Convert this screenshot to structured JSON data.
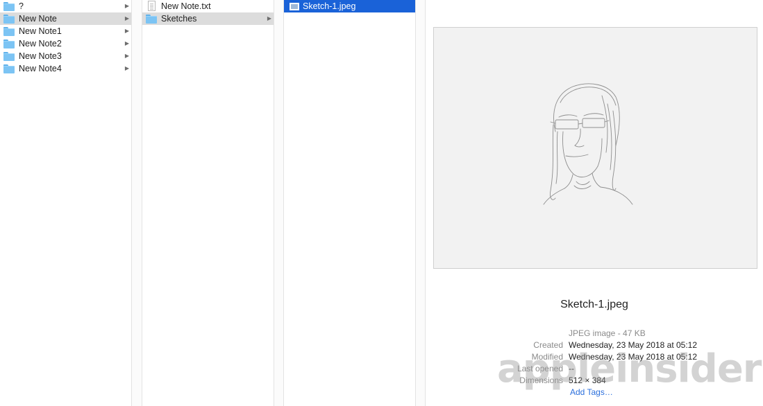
{
  "columns": [
    {
      "items": [
        {
          "label": "?",
          "icon": "folder-icon",
          "chevron": true,
          "selected": "none"
        },
        {
          "label": "New Note",
          "icon": "folder-icon",
          "chevron": true,
          "selected": "gray"
        },
        {
          "label": "New Note1",
          "icon": "folder-icon",
          "chevron": true,
          "selected": "none"
        },
        {
          "label": "New Note2",
          "icon": "folder-icon",
          "chevron": true,
          "selected": "none"
        },
        {
          "label": "New Note3",
          "icon": "folder-icon",
          "chevron": true,
          "selected": "none"
        },
        {
          "label": "New Note4",
          "icon": "folder-icon",
          "chevron": true,
          "selected": "none"
        }
      ]
    },
    {
      "items": [
        {
          "label": "New Note.txt",
          "icon": "text-file-icon",
          "chevron": false,
          "selected": "none"
        },
        {
          "label": "Sketches",
          "icon": "folder-icon",
          "chevron": true,
          "selected": "gray"
        }
      ]
    },
    {
      "items": [
        {
          "label": "Sketch-1.jpeg",
          "icon": "image-file-icon",
          "chevron": false,
          "selected": "blue"
        }
      ]
    }
  ],
  "preview": {
    "filename": "Sketch-1.jpeg",
    "kind": "JPEG image - 47 KB",
    "meta": [
      {
        "label": "Created",
        "value": "Wednesday, 23 May 2018 at 05:12"
      },
      {
        "label": "Modified",
        "value": "Wednesday, 23 May 2018 at 05:12"
      },
      {
        "label": "Last opened",
        "value": "--"
      },
      {
        "label": "Dimensions",
        "value": "512 × 384"
      }
    ],
    "add_tags": "Add Tags…"
  },
  "watermark": "appleinsider",
  "colors": {
    "selection_blue": "#1a62d8",
    "selection_gray": "#dcdcdc",
    "folder": "#7cc4f4",
    "link": "#2b6fdc"
  }
}
